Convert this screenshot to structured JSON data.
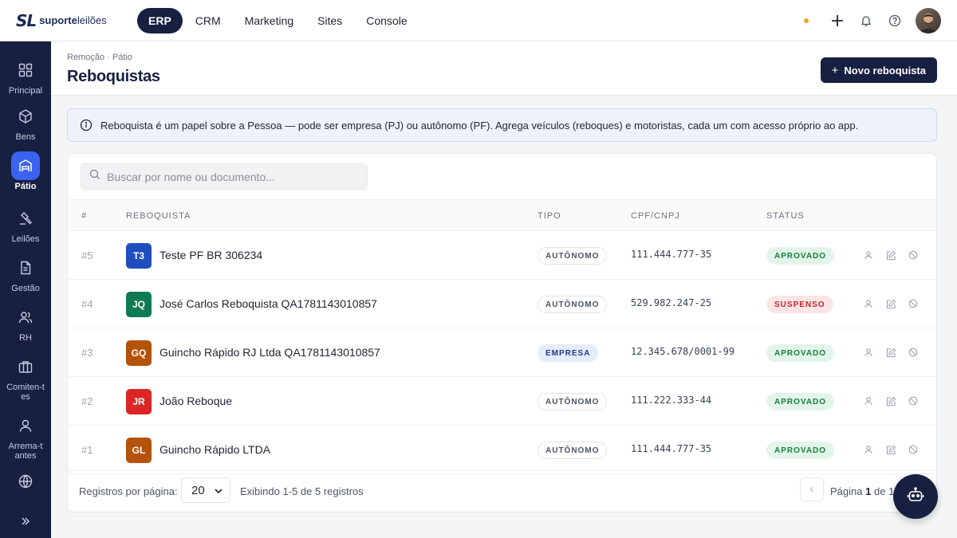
{
  "brand": {
    "mark": "SL",
    "name_bold": "suporte",
    "name_thin": "leilões"
  },
  "nav": [
    {
      "label": "ERP",
      "active": true
    },
    {
      "label": "CRM"
    },
    {
      "label": "Marketing"
    },
    {
      "label": "Sites"
    },
    {
      "label": "Console"
    }
  ],
  "top_icons": [
    "status-dot",
    "plus-icon",
    "bell-icon",
    "help-icon",
    "user-avatar"
  ],
  "sidebar": [
    {
      "label": "Principal",
      "icon": "grid-icon"
    },
    {
      "label": "Bens",
      "icon": "cube-icon"
    },
    {
      "label": "Pátio",
      "icon": "warehouse-icon",
      "active": true
    },
    {
      "label": "Leilões",
      "icon": "gavel-icon"
    },
    {
      "label": "Gestão",
      "icon": "document-icon"
    },
    {
      "label": "RH",
      "icon": "users-icon"
    },
    {
      "label": "Comiten-tes",
      "icon": "briefcase-icon"
    },
    {
      "label": "Arrema-tantes",
      "icon": "user-icon"
    },
    {
      "label": "",
      "icon": "globe-icon"
    }
  ],
  "header": {
    "breadcrumb": "Remoção · Pátio",
    "title": "Reboquistas",
    "new_button": "Novo reboquista"
  },
  "info": "Reboquista é um papel sobre a Pessoa — pode ser empresa (PJ) ou autônomo (PF). Agrega veículos (reboques) e motoristas, cada um com acesso próprio ao app.",
  "search": {
    "placeholder": "Buscar por nome ou documento..."
  },
  "table": {
    "columns": [
      "#",
      "Reboquista",
      "Tipo",
      "CPF/CNPJ",
      "Status"
    ],
    "rows": [
      {
        "id": "#5",
        "initials": "T3",
        "color": "#1f4fbf",
        "name": "Teste PF BR 306234",
        "type": "AUTÔNOMO",
        "doc": "111.444.777-35",
        "status": "APROVADO"
      },
      {
        "id": "#4",
        "initials": "JQ",
        "color": "#0f7a52",
        "name": "José Carlos Reboquista QA1781143010857",
        "type": "AUTÔNOMO",
        "doc": "529.982.247-25",
        "status": "SUSPENSO"
      },
      {
        "id": "#3",
        "initials": "GQ",
        "color": "#b45309",
        "name": "Guincho Rápido RJ Ltda QA1781143010857",
        "type": "EMPRESA",
        "doc": "12.345.678/0001-99",
        "status": "APROVADO"
      },
      {
        "id": "#2",
        "initials": "JR",
        "color": "#dc2626",
        "name": "João Reboque",
        "type": "AUTÔNOMO",
        "doc": "111.222.333-44",
        "status": "APROVADO"
      },
      {
        "id": "#1",
        "initials": "GL",
        "color": "#b45309",
        "name": "Guincho Rápido LTDA",
        "type": "AUTÔNOMO",
        "doc": "111.444.777-35",
        "status": "APROVADO"
      }
    ]
  },
  "footer": {
    "per_page_label": "Registros por página:",
    "per_page_value": "20",
    "showing": "Exibindo 1-5 de 5 registros",
    "page_label": "Página",
    "page": "1",
    "of": "de",
    "total_pages": "1"
  }
}
